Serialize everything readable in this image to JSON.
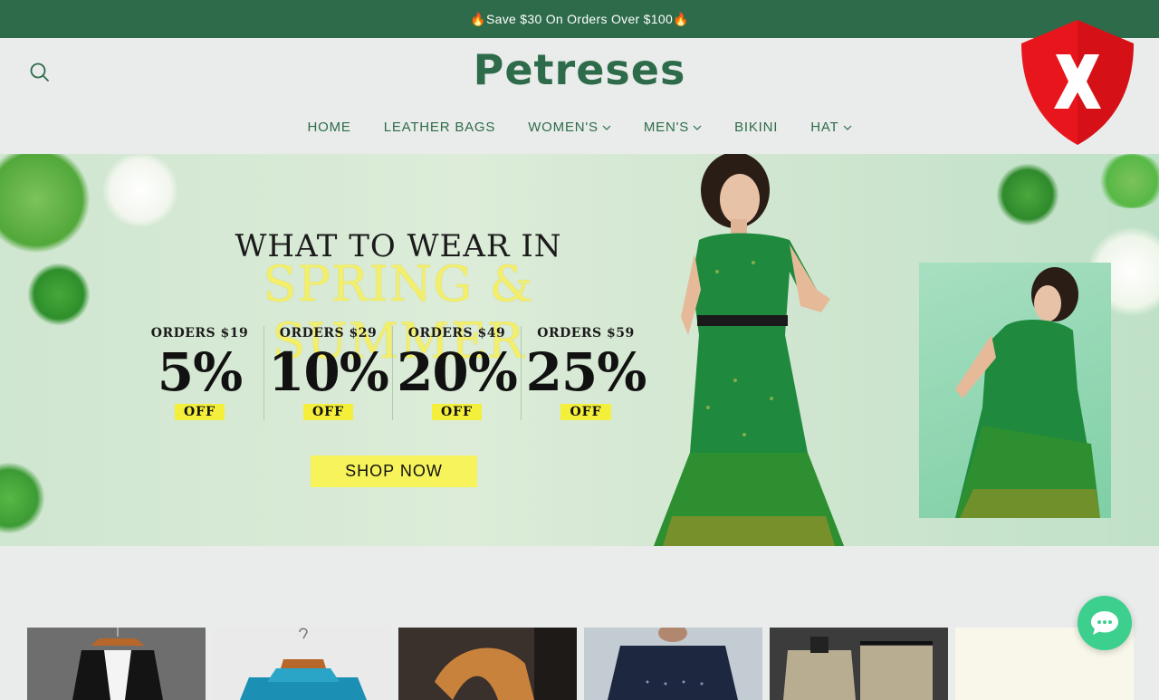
{
  "announcement": {
    "text": "🔥Save $30 On Orders Over $100🔥"
  },
  "header": {
    "logo": "Petreses"
  },
  "nav": {
    "home": "HOME",
    "leather_bags": "LEATHER BAGS",
    "womens": "WOMEN'S",
    "mens": "MEN'S",
    "bikini": "BIKINI",
    "hat": "HAT"
  },
  "hero": {
    "headline": "WHAT TO WEAR IN",
    "subheadline": "SPRING & SUMMER",
    "offers": [
      {
        "label": "ORDERS $19",
        "percent": "5%",
        "off": "OFF"
      },
      {
        "label": "ORDERS $29",
        "percent": "10%",
        "off": "OFF"
      },
      {
        "label": "ORDERS $49",
        "percent": "20%",
        "off": "OFF"
      },
      {
        "label": "ORDERS $59",
        "percent": "25%",
        "off": "OFF"
      }
    ],
    "cta": "SHOP NOW"
  },
  "colors": {
    "brand_green": "#2e6b4a",
    "accent_yellow": "#f6f35b",
    "chat_green": "#3ccf8e",
    "shield_red": "#e8161c"
  },
  "icons": {
    "search": "search-icon",
    "chevron": "chevron-down-icon",
    "shield": "shield-x-icon",
    "chat": "chat-bubble-icon"
  }
}
